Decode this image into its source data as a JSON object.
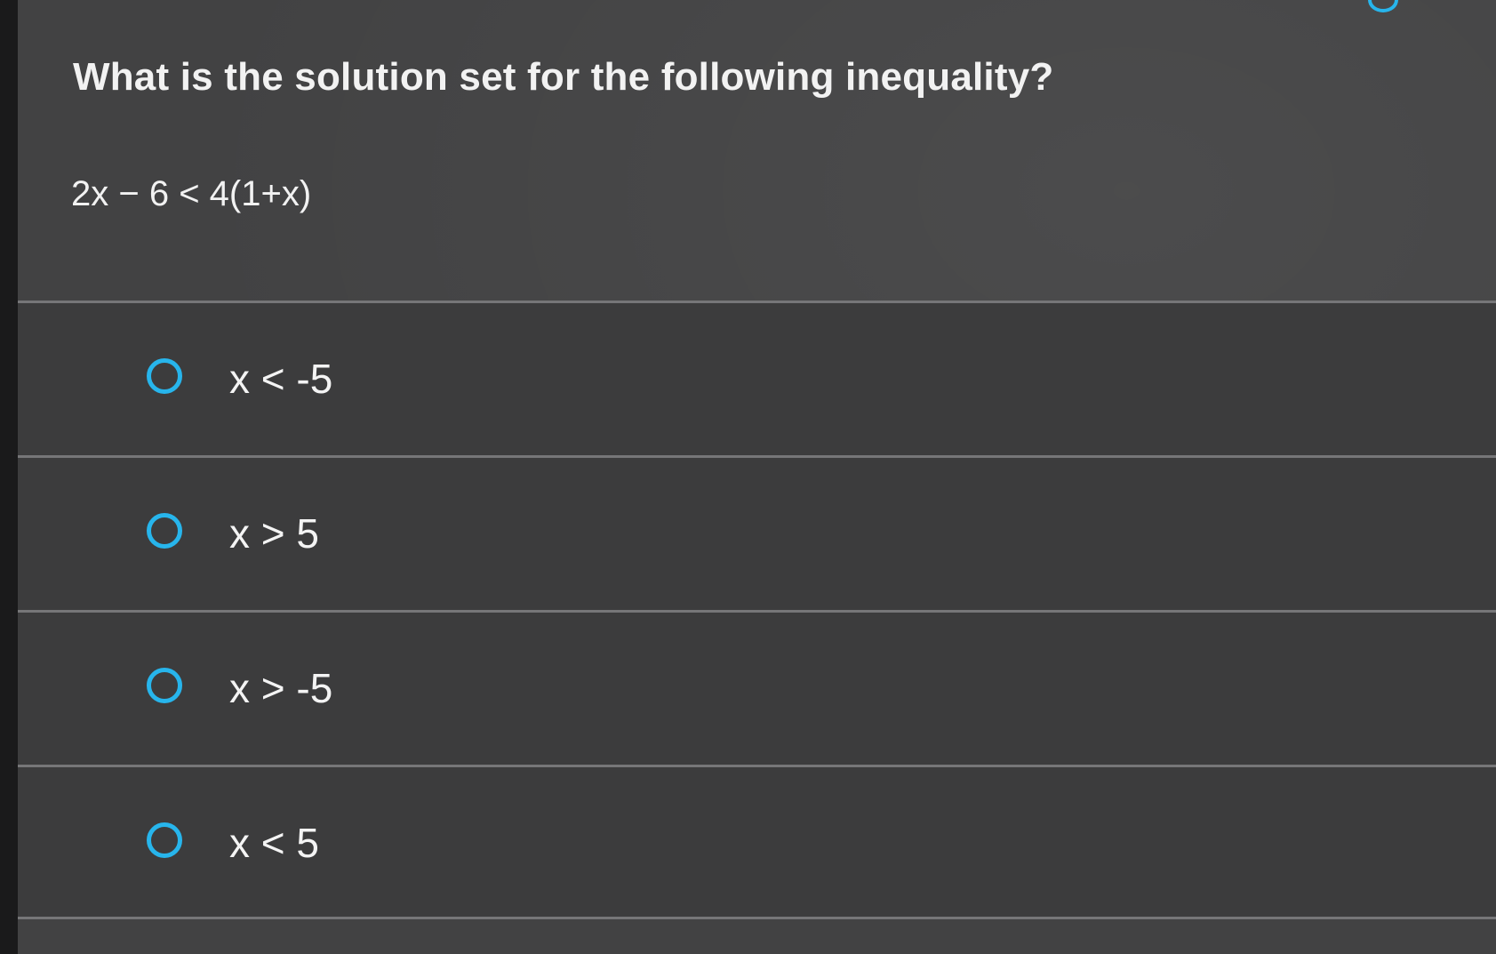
{
  "question": {
    "text": "What is the solution set for the following inequality?",
    "equation": "2x − 6 < 4(1+x)"
  },
  "options": [
    {
      "label": "x < -5",
      "selected": false
    },
    {
      "label": "x > 5",
      "selected": false
    },
    {
      "label": "x > -5",
      "selected": false
    },
    {
      "label": "x < 5",
      "selected": false
    }
  ],
  "colors": {
    "accent": "#27b5ec",
    "background": "#424243",
    "text": "#f2f2f2"
  }
}
